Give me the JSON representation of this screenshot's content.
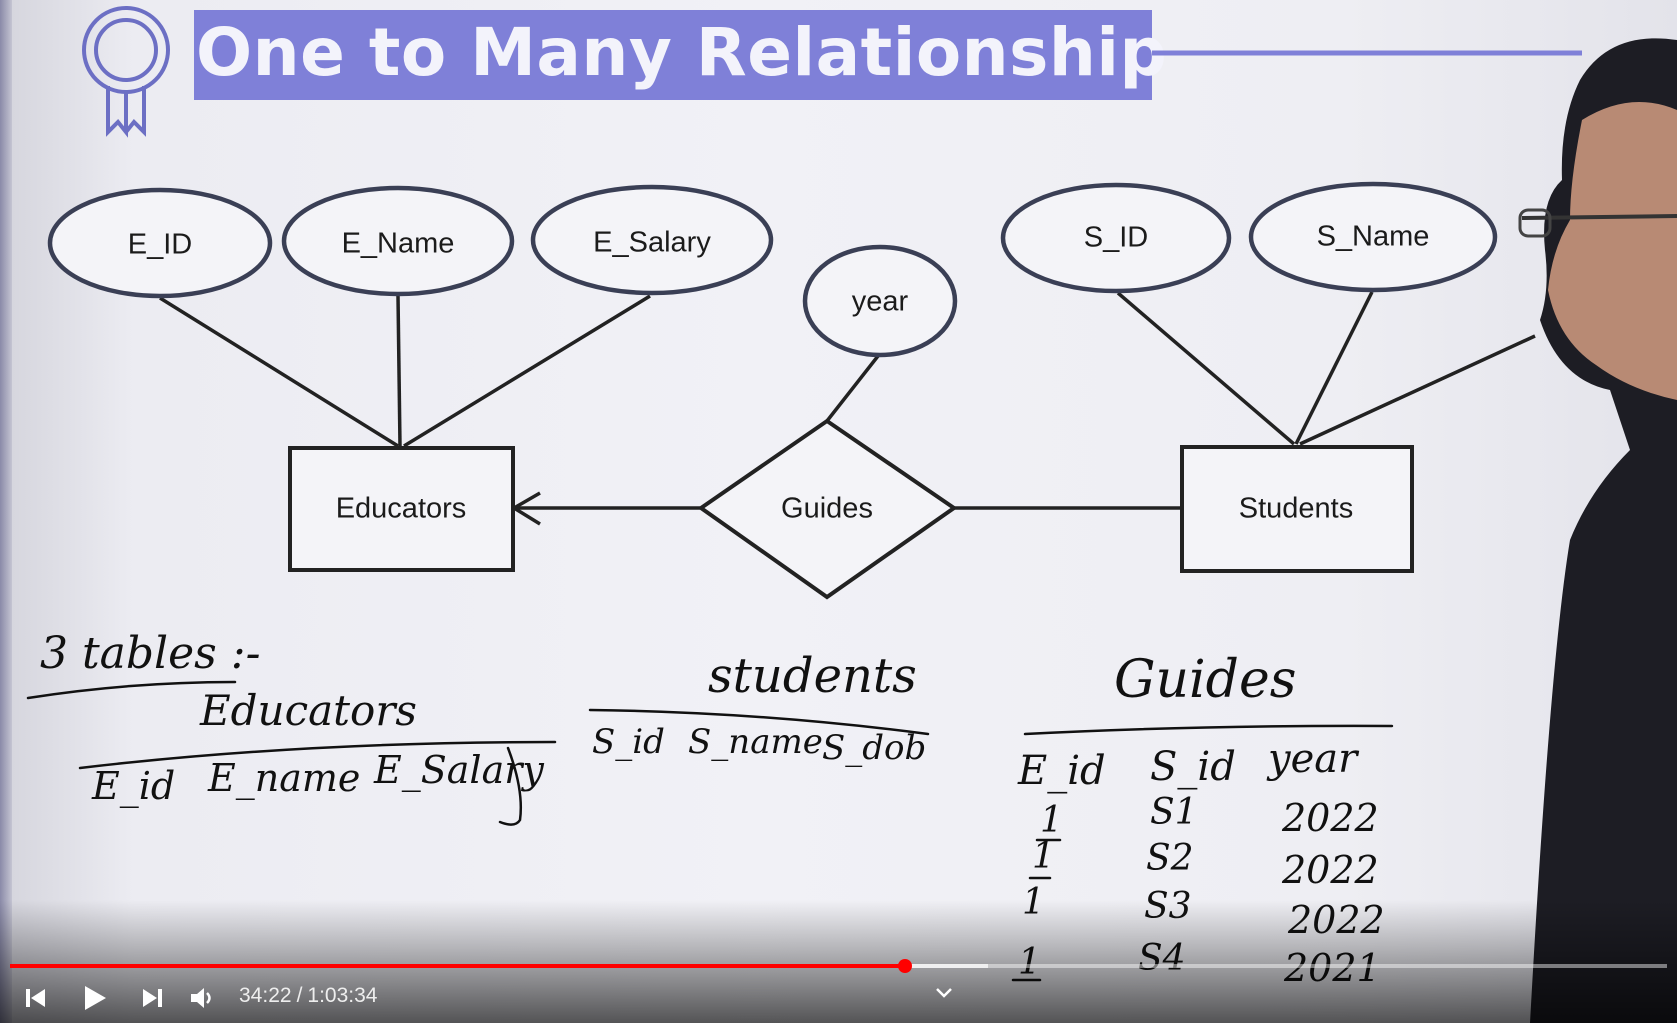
{
  "slide": {
    "title": "One to Many Relationship",
    "accent_color": "#7f80d8",
    "badge_icon": "award-ribbon-icon"
  },
  "er_diagram": {
    "entities": [
      "Educators",
      "Students"
    ],
    "relationship": "Guides",
    "educator_attributes": [
      "E_ID",
      "E_Name",
      "E_Salary"
    ],
    "student_attributes": [
      "S_ID",
      "S_Name"
    ],
    "relationship_attribute": "year"
  },
  "notes": {
    "heading": "3 tables :-",
    "educators_table": {
      "name": "Educators",
      "columns": [
        "E_id",
        "E_name",
        "E_Salary"
      ]
    },
    "students_table": {
      "name": "students",
      "columns": [
        "S_id",
        "S_name",
        "S_dob"
      ]
    },
    "guides_table": {
      "name": "Guides",
      "columns": [
        "E_id",
        "S_id",
        "year"
      ],
      "rows": [
        [
          "1",
          "S1",
          "2022"
        ],
        [
          "1",
          "S2",
          "2022"
        ],
        [
          "1",
          "S3",
          "2022"
        ],
        [
          "1",
          "S4",
          "2021"
        ]
      ]
    }
  },
  "player": {
    "current_time": "34:22",
    "duration": "1:03:34",
    "progress_fraction": 0.54,
    "buffered_fraction": 0.59,
    "progress_color": "#ff0000",
    "icons": [
      "previous-icon",
      "play-icon",
      "next-icon",
      "volume-icon",
      "chevron-down-icon"
    ]
  }
}
